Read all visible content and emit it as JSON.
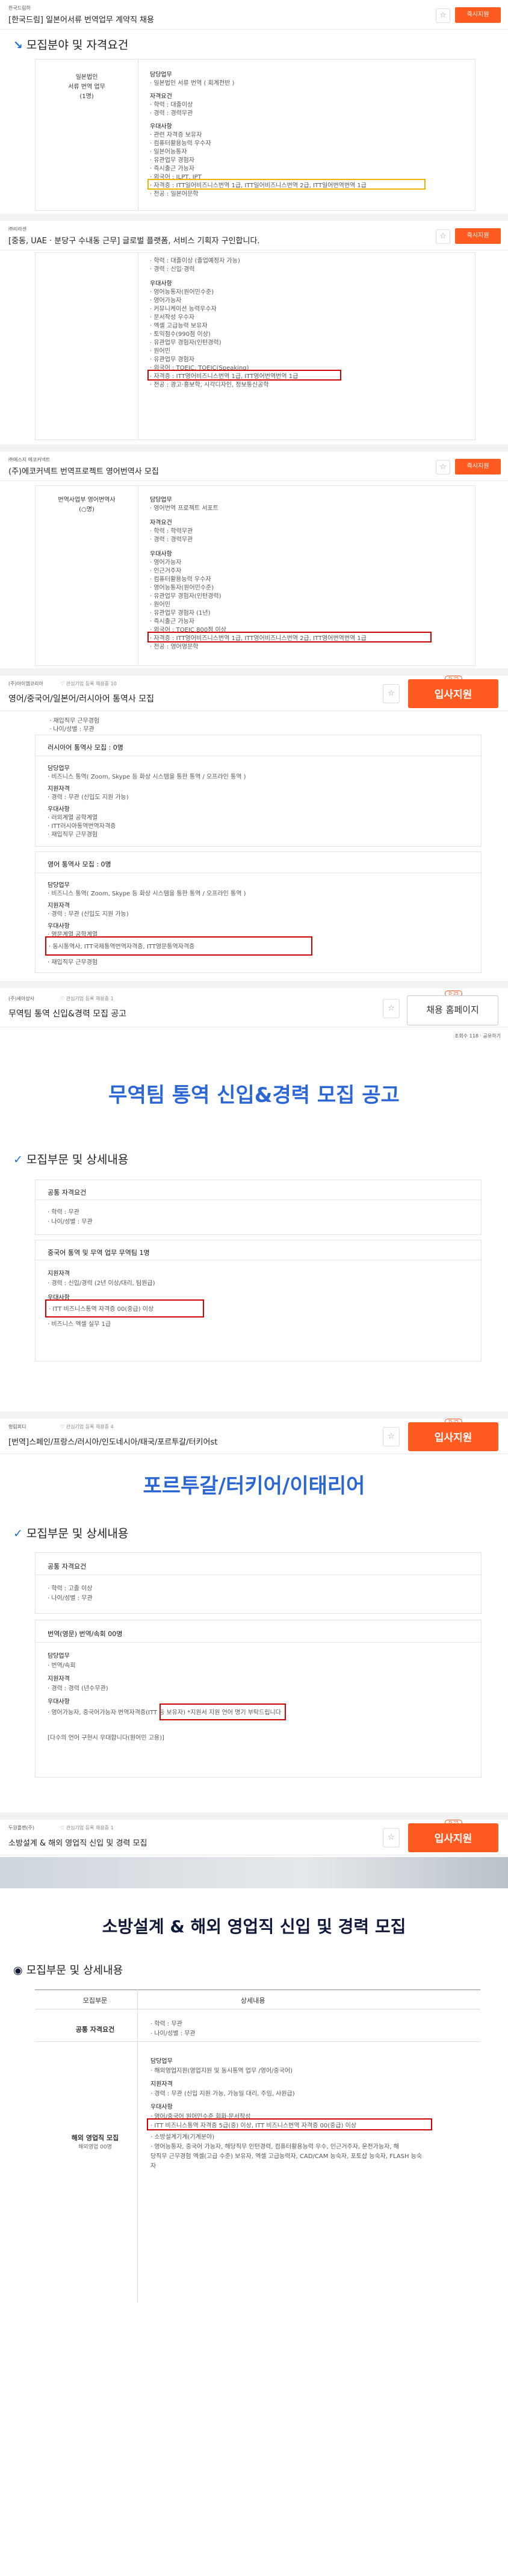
{
  "p1": {
    "company": "한국드림하",
    "title": "[한국드림] 일본어서류 번역업무 계약직 채용",
    "apply": "즉시지원",
    "section": "모집분야 및 자격요건",
    "left": [
      "일본법인",
      "서류 번역 업무",
      "(1명)"
    ],
    "lines": [
      "담당업무",
      "· 일본법인 서류 번역 ( 회계전반 )",
      "자격요건",
      "· 학력 : 대졸이상",
      "· 경력 : 경력무관",
      "우대사항",
      "· 관련 자격증 보유자",
      "· 컴퓨터활용능력 우수자",
      "· 일본어능통자",
      "· 유관업무 경험자",
      "· 즉시출근 가능자",
      "· 외국어 : JLPT, JPT",
      "· 자격증 : ITT일어비즈니스번역 1급, ITT일어비즈니스번역 2급, ITT일어번역번역 1급",
      "· 전공 : 일본어문학"
    ]
  },
  "p2": {
    "company": "㈜리라센",
    "title": "[중동, UAE · 분당구 수내동 근무] 글로벌 플랫폼, 서비스 기획자 구인합니다.",
    "apply": "즉시지원",
    "lines": [
      "· 학력 : 대졸이상 (졸업예정자 가능)",
      "· 경력 : 신입·경력",
      "우대사항",
      "· 영어능통자(원어민수준)",
      "· 영어가능자",
      "· 커뮤니케이션 능력우수자",
      "· 문서작성 우수자",
      "· 엑셀 고급능력 보유자",
      "· 토익점수(990점 이상)",
      "· 유관업무 경험자(인턴경력)",
      "· 원어민",
      "· 유관업무 경험자",
      "· 외국어 : TOEIC, TOEIC(Speaking)",
      "· 자격증 : ITT영어비즈니스번역 1급, ITT영어번역번역 1급",
      "· 전공 : 광고·홍보학, 시각디자인, 정보통신공학"
    ]
  },
  "p3": {
    "company": "㈜에스지 에코커넥트",
    "title": "(주)에코커넥트 번역프로젝트 영어번역사 모집",
    "apply": "즉시지원",
    "left": [
      "번역사업부 영어번역사",
      "(○명)"
    ],
    "lines": [
      "담당업무",
      "· 영어번역 프로젝트 서포트",
      "자격요건",
      "· 학력 : 학력무관",
      "· 경력 : 경력무관",
      "우대사항",
      "· 영어가능자",
      "· 인근거주자",
      "· 컴퓨터활용능력 우수자",
      "· 영어능통자(원어민수준)",
      "· 유관업무 경험자(인턴경력)",
      "· 원어민",
      "· 유관업무 경험자 (1년)",
      "· 즉시출근 가능자",
      "· 외국어 : TOEIC 800점 이상",
      "· 자격증 : ITT영어비즈니스번역 1급, ITT영어비즈니스번역 2급, ITT영어번역번역 1급",
      "· 전공 : 영어영문학"
    ]
  },
  "p4": {
    "company": "(주)아이엠코리아",
    "meta": "♡ 관심기업 등록    채용중 10",
    "title": "영어/중국어/일본어/러시아어 통역사 모집",
    "badge": "D-25",
    "apply": "입사지원",
    "lines": [
      "· 재입직무 근무경험",
      "· 나이/성별 : 무관",
      "러시아어 통역사 모집 : 0명",
      "담당업무",
      "· 비즈니스 통역( Zoom, Skype 등 화상 시스템을 통한 통역 / 오프라인 통역 )",
      "지원자격",
      "· 경력 : 무관 (신입도 지원 가능)",
      "우대사항",
      "· 러외계열 공학계열",
      "· ITT러시아통역번역자격증",
      "· 재입직무 근무경험",
      "영어 통역사 모집 : 0명",
      "담당업무",
      "· 비즈니스 통역( Zoom, Skype 등 화상 시스템을 통한 통역 / 오프라인 통역 )",
      "지원자격",
      "· 경력 : 무관 (신입도 지원 가능)",
      "우대사항",
      "· 영문계열 공학계열",
      "· 동시통역사, ITT국제통역번역자격증, ITT영문통역자격증",
      "· 재입직무 근무경험"
    ]
  },
  "p5": {
    "company": "(주)세아상사",
    "meta": "♡ 관심기업 등록    채용중 1",
    "title": "무역팀 통역 신입&경력 모집 공고",
    "badge": "D-25",
    "apply": "채용 홈페이지",
    "views": "조회수 118  ·  공유하기",
    "big": "무역팀 통역 신입&경력 모집 공고",
    "section": "모집부문 및 상세내용",
    "lines": [
      "공통 자격요건",
      "· 학력 : 무관",
      "· 나이/성별 : 무관",
      "중국어 통역 및 무역 업무  무역팀 1명",
      "지원자격",
      "· 경력 : 신입/경력 (2년 이상/대리, 팀원급)",
      "우대사항",
      "· ITT 비즈니스통역 자격증 00(중급) 이상",
      "· 비즈니스 엑셀 실무 1급"
    ]
  },
  "p6": {
    "company": "형림피디",
    "meta": "♡ 관심기업 등록    채용중 4",
    "title": "[번역]스페인/프랑스/러시아/인도네시아/태국/포르투갈/터키어st",
    "badge": "D-25",
    "apply": "입사지원",
    "big": "포르투갈/터키어/이태리어",
    "section": "모집부문 및 상세내용",
    "lines": [
      "공통 자격요건",
      "· 학력 : 고졸 이상",
      "· 나이/성별 : 무관",
      "번역(영문)  번역/속회 00명",
      "담당업무",
      "· 번역/속회",
      "지원자격",
      "· 경력 : 경력 (년수무관)",
      "우대사항",
      "· 영어가능자, 중국어가능자  번역자격증(ITT 등 보유자)  *지원서 지원 언어 명기 부탁드립니다",
      "[다수의 언어 구현시 우대합니다(원어민 고용)]"
    ]
  },
  "p7": {
    "company": "두원플랜(주)",
    "meta": "♡ 관심기업 등록    채용중 1",
    "title": "소방설계 & 해외 영업직 신입 및 경력 모집",
    "badge": "D-25",
    "apply": "입사지원",
    "big": "소방설계 & 해외 영업직 신입 및 경력 모집",
    "section": "모집부문 및 상세내용",
    "th1": "모집부문",
    "th2": "상세내용",
    "row1": "공통 자격요건",
    "row2": [
      "해외 영업직 모집",
      "해외영업 00명"
    ],
    "lines": [
      "· 학력 : 무관",
      "· 나이/성별 : 무관",
      "담당업무",
      "· 해외영업지원(영업지원 및 동시통역 업무 /영어/중국어)",
      "지원자격",
      "· 경력 : 무관 (신입 지원 가능, 가능일 대리, 주임, 사원급)",
      "우대사항",
      "· 영어/중국어 원어민수준 회화·문서작성",
      "· ITT 비즈니스통역 자격증 5급(중) 이상, ITT 비즈니스번역 자격증 00(중급) 이상",
      "· 소방설계기계(기계분야)",
      "· 영어능통자, 중국어 가능자, 해당직무 인턴경력, 컴퓨터활용능력 우수, 인근거주자, 운전가능자, 해",
      "  당직무 근무경험 엑셀(고급 수준) 보유자, 엑셀 고급능력자, CAD/CAM 능숙자, 포토샵 능숙자, FLASH 능숙",
      "  자"
    ]
  }
}
